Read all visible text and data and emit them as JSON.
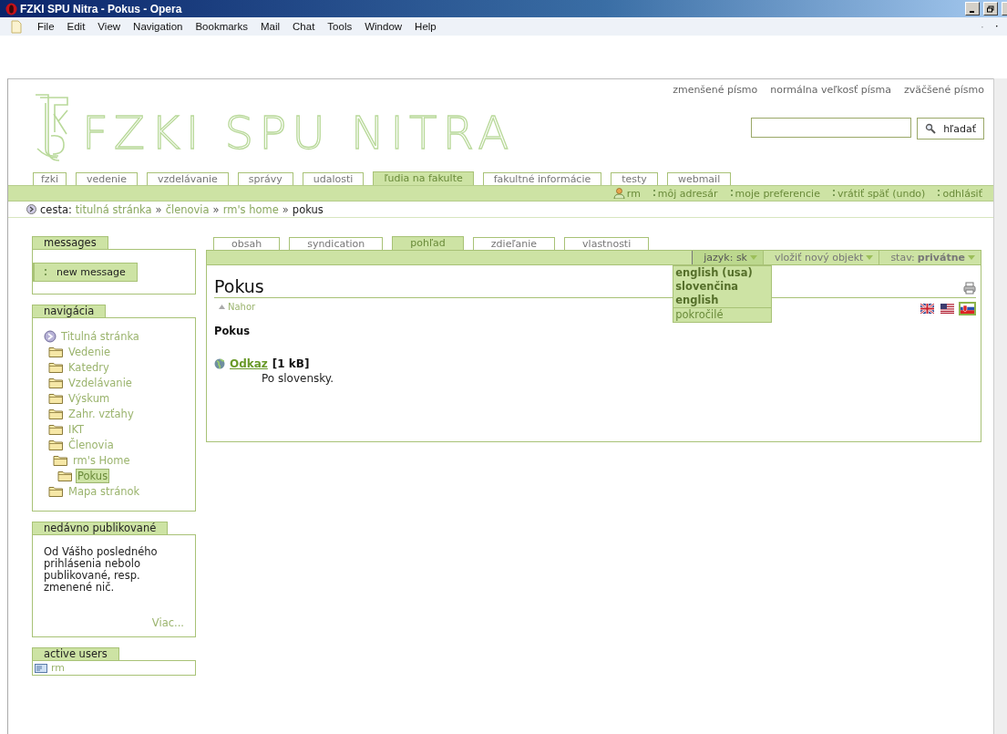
{
  "window": {
    "title": "FZKI SPU Nitra - Pokus - Opera"
  },
  "menu_bar": [
    "File",
    "Edit",
    "View",
    "Navigation",
    "Bookmarks",
    "Mail",
    "Chat",
    "Tools",
    "Window",
    "Help"
  ],
  "font_size_links": [
    "zmenšené písmo",
    "normálna veľkosť písma",
    "zväčšené písmo"
  ],
  "logo": {
    "text": "FZKI SPU NITRA"
  },
  "search": {
    "button": "hľadať"
  },
  "main_tabs": [
    {
      "label": "fzki",
      "selected": false
    },
    {
      "label": "vedenie",
      "selected": false
    },
    {
      "label": "vzdelávanie",
      "selected": false
    },
    {
      "label": "správy",
      "selected": false
    },
    {
      "label": "udalosti",
      "selected": false
    },
    {
      "label": "ľudia na fakulte",
      "selected": true
    },
    {
      "label": "fakultné informácie",
      "selected": false
    },
    {
      "label": "testy",
      "selected": false
    },
    {
      "label": "webmail",
      "selected": false
    }
  ],
  "user_links": [
    {
      "label": "rm",
      "kind": "user"
    },
    {
      "label": "môj adresár",
      "kind": "link"
    },
    {
      "label": "moje preferencie",
      "kind": "link"
    },
    {
      "label": "vrátiť späť (undo)",
      "kind": "link"
    },
    {
      "label": "odhlásiť",
      "kind": "link"
    }
  ],
  "breadcrumb": {
    "label": "cesta:",
    "separator": "»",
    "items": [
      "titulná stránka",
      "členovia",
      "rm's home"
    ],
    "current": "pokus"
  },
  "messages": {
    "title": "messages",
    "button": "new message"
  },
  "navigation": {
    "title": "navigácia",
    "tree": [
      {
        "label": "Titulná stránka",
        "kind": "home",
        "selected": false,
        "children": [
          {
            "label": "Vedenie",
            "kind": "folder",
            "selected": false
          },
          {
            "label": "Katedry",
            "kind": "folder",
            "selected": false
          },
          {
            "label": "Vzdelávanie",
            "kind": "folder",
            "selected": false
          },
          {
            "label": "Výskum",
            "kind": "folder",
            "selected": false
          },
          {
            "label": "Zahr. vzťahy",
            "kind": "folder",
            "selected": false
          },
          {
            "label": "IKT",
            "kind": "folder",
            "selected": false
          },
          {
            "label": "Členovia",
            "kind": "folder",
            "selected": false,
            "children": [
              {
                "label": "rm's Home",
                "kind": "folder",
                "selected": false,
                "children": [
                  {
                    "label": "Pokus",
                    "kind": "folder",
                    "selected": true
                  }
                ]
              }
            ]
          },
          {
            "label": "Mapa stránok",
            "kind": "folder",
            "selected": false
          }
        ]
      }
    ]
  },
  "recent": {
    "title": "nedávno publikované",
    "text": "Od Vášho posledného prihlásenia nebolo publikované, resp. zmenené nič.",
    "more": "Viac..."
  },
  "active_users": {
    "title": "active users",
    "users": [
      "rm"
    ]
  },
  "content_tabs": [
    {
      "label": "obsah",
      "selected": false
    },
    {
      "label": "syndication",
      "selected": false
    },
    {
      "label": "pohľad",
      "selected": true
    },
    {
      "label": "zdieľanie",
      "selected": false
    },
    {
      "label": "vlastnosti",
      "selected": false
    }
  ],
  "actions": [
    {
      "label": "jazyk: sk",
      "expanded": true
    },
    {
      "label": "vložiť nový objekt",
      "expanded": false
    },
    {
      "label": "stav: **privátne**",
      "expanded": false
    }
  ],
  "language_menu": [
    {
      "label": "english (usa)",
      "kind": "language"
    },
    {
      "label": "slovenčina",
      "kind": "language"
    },
    {
      "label": "english",
      "kind": "language"
    },
    {
      "label": "pokročilé",
      "kind": "advanced"
    }
  ],
  "document": {
    "title": "Pokus",
    "up_link": "Nahor",
    "heading": "Pokus",
    "attachment": {
      "link": "Odkaz",
      "size": "[1 kB]",
      "description": "Po slovensky."
    }
  },
  "flags": [
    {
      "kind": "uk",
      "selected": false
    },
    {
      "kind": "us",
      "selected": false
    },
    {
      "kind": "sk",
      "selected": true
    }
  ]
}
